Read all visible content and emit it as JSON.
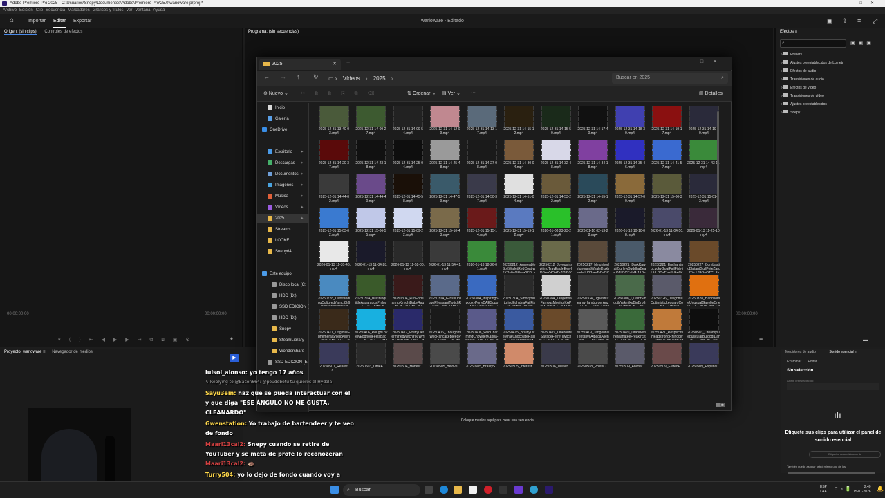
{
  "app": {
    "title": "Adobe Premiere Pro 2025 - C:\\Usuarios\\Snepy\\Documentos\\Adobe\\Premiere Pro\\25.0\\warioware.prproj *",
    "menu": [
      "Archivo",
      "Edición",
      "Clip",
      "Secuencia",
      "Marcadores",
      "Gráficos y títulos",
      "Ver",
      "Ventana",
      "Ayuda"
    ],
    "tabs": {
      "import": "Importar",
      "edit": "Editar",
      "export": "Exportar"
    },
    "project_title": "warioware - Editado"
  },
  "source_panel": {
    "tab_source": "Origen: (sin clips)",
    "tab_controls": "Controles de efectos",
    "timecode": "00;00;00;00",
    "timecode2": "00;00;00;00"
  },
  "program_panel": {
    "tab": "Programa: (sin secuencias)",
    "timecode": "00;00;00;00",
    "timecode_right": "00;00;00;00",
    "drop_hint": "Coloque medios aquí para crear una secuencia."
  },
  "effects_panel": {
    "tab": "Efectos",
    "items": [
      "Presets",
      "Ajustes preestablecidos de Lumetri",
      "Efectos de audio",
      "Transiciones de audio",
      "Efectos de vídeo",
      "Transiciones de vídeo",
      "Ajustes preestablecidos",
      "Snepy"
    ]
  },
  "project_panel": {
    "tab": "Proyecto: warioware",
    "tab2": "Navegador de medios"
  },
  "audio_panel": {
    "tab1": "Medidores de audio",
    "tab2": "Sonido esencial",
    "sub1": "Examinar",
    "sub2": "Editar",
    "selection": "Sin selección",
    "preset_label": "Ajuste preestablecido:",
    "heading": "Etiquete sus clips para utilizar el panel de sonido esencial",
    "auto_btn": "Etiquetar automáticamente",
    "foot": "También puede asignar usted mismo uno de los"
  },
  "explorer": {
    "tab_title": "2025",
    "breadcrumb": [
      "Vídeos",
      "2025"
    ],
    "search_placeholder": "Buscar en 2025",
    "toolbar": {
      "new": "Nuevo",
      "sort": "Ordenar",
      "view": "Ver",
      "details": "Detalles"
    },
    "sidebar": [
      {
        "label": "Inicio",
        "icon": "home-icon",
        "color": "#d9d9d9"
      },
      {
        "label": "Galería",
        "icon": "gallery-icon",
        "color": "#5aa0e8"
      },
      {
        "label": "OneDrive",
        "icon": "cloud-icon",
        "color": "#3a8ee6"
      },
      {
        "label": "Escritorio",
        "icon": "desktop-icon",
        "color": "#4b9be8"
      },
      {
        "label": "Descargas",
        "icon": "download-icon",
        "color": "#45b06a"
      },
      {
        "label": "Documentos",
        "icon": "document-icon",
        "color": "#6f9fd8"
      },
      {
        "label": "Imágenes",
        "icon": "image-icon",
        "color": "#4aa3df"
      },
      {
        "label": "Música",
        "icon": "music-icon",
        "color": "#e0603a"
      },
      {
        "label": "Vídeos",
        "icon": "video-icon",
        "color": "#9b5ce0"
      },
      {
        "label": "2025",
        "icon": "folder-icon",
        "color": "#e8b84a"
      },
      {
        "label": "Streams",
        "icon": "folder-icon",
        "color": "#e8b84a"
      },
      {
        "label": "LOCKE",
        "icon": "folder-icon",
        "color": "#e8b84a"
      },
      {
        "label": "Snepy64",
        "icon": "folder-icon",
        "color": "#e8b84a"
      },
      {
        "label": "Este equipo",
        "icon": "computer-icon",
        "color": "#4b9be8"
      },
      {
        "label": "Disco local (C:",
        "icon": "drive-icon",
        "color": "#999"
      },
      {
        "label": "HDD (D:)",
        "icon": "drive-icon",
        "color": "#999"
      },
      {
        "label": "SSD EDICION (",
        "icon": "drive-icon",
        "color": "#999"
      },
      {
        "label": "HDD (D:)",
        "icon": "drive-icon",
        "color": "#999"
      },
      {
        "label": "Snepy",
        "icon": "folder-icon",
        "color": "#e8b84a"
      },
      {
        "label": "SteamLibrary",
        "icon": "folder-icon",
        "color": "#e8b84a"
      },
      {
        "label": "Wondershare",
        "icon": "folder-icon",
        "color": "#e8b84a"
      },
      {
        "label": "SSD EDICION (E:",
        "icon": "drive-icon",
        "color": "#999"
      }
    ],
    "files": [
      {
        "name": "2025-12-31 13-40-03.mp4",
        "color": "#4a5a3a"
      },
      {
        "name": "2025-12-31 14-09-27.mp4",
        "color": "#3d5a30"
      },
      {
        "name": "2025-12-31 14-09-54.mp4",
        "color": "#222"
      },
      {
        "name": "2025-12-31 14-12-09.mp4",
        "color": "#c08890"
      },
      {
        "name": "2025-12-31 14-13-17.mp4",
        "color": "#5a6a7a"
      },
      {
        "name": "2025-12-31 14-15-12.mp4",
        "color": "#2a2010"
      },
      {
        "name": "2025-12-31 14-15-50.mp4",
        "color": "#1a2a1a"
      },
      {
        "name": "2025-12-31 14-17-40.mp4",
        "color": "#111"
      },
      {
        "name": "2025-12-31 14-18-30.mp4",
        "color": "#4040b0"
      },
      {
        "name": "2025-12-31 14-19-17.mp4",
        "color": "#8a1010"
      },
      {
        "name": "2025-12-31 14-19-30.mp4",
        "color": "#2a2a3a"
      },
      {
        "name": "2025-12-31 14-20-37.mp4",
        "color": "#5a0a0a"
      },
      {
        "name": "2025-12-31 14-23-18.mp4",
        "color": "#111"
      },
      {
        "name": "2025-12-31 14-25-04.mp4",
        "color": "#0e0e0e"
      },
      {
        "name": "2025-12-31 14-25-48.mp4",
        "color": "#9a9a9a"
      },
      {
        "name": "2025-12-31 14-27-08.mp4",
        "color": "#1a1a1a"
      },
      {
        "name": "2025-12-31 14-30-04.mp4",
        "color": "#7a5a3a"
      },
      {
        "name": "2025-12-31 14-32-48.mp4",
        "color": "#d8d8e8"
      },
      {
        "name": "2025-12-31 14-34-18.mp4",
        "color": "#8040a0"
      },
      {
        "name": "2025-12-31 14-35-46.mp4",
        "color": "#3030c0"
      },
      {
        "name": "2025-12-31 14-41-57.mp4",
        "color": "#3a6ad0"
      },
      {
        "name": "2025-12-31 14-43-11.mp4",
        "color": "#3a8a3a"
      },
      {
        "name": "2025-12-31 14-44-02.mp4",
        "color": "#3a3a3a"
      },
      {
        "name": "2025-12-31 14-44-40.mp4",
        "color": "#6a4a8a"
      },
      {
        "name": "2025-12-31 14-45-58.mp4",
        "color": "#1a1008"
      },
      {
        "name": "2025-12-31 14-47-59.mp4",
        "color": "#3a5a6a"
      },
      {
        "name": "2025-12-31 14-50-37.mp4",
        "color": "#3a3a4a"
      },
      {
        "name": "2025-12-31 14-51-04.mp4",
        "color": "#e0e0e0"
      },
      {
        "name": "2025-12-31 14-53-22.mp4",
        "color": "#6a5a3a"
      },
      {
        "name": "2025-12-31 14-55-12.mp4",
        "color": "#2a4a5a"
      },
      {
        "name": "2025-12-31 14-57-00.mp4",
        "color": "#8a6a3a"
      },
      {
        "name": "2025-12-31 15-00-34.mp4",
        "color": "#5a5a3a"
      },
      {
        "name": "2025-12-31 15-01-13.mp4",
        "color": "#2a2a3a"
      },
      {
        "name": "2025-12-31 15-03-02.mp4",
        "color": "#3a7ad0"
      },
      {
        "name": "2025-12-31 15-06-55.mp4",
        "color": "#c0c8e8"
      },
      {
        "name": "2025-12-31 15-09-22.mp4",
        "color": "#d0d8f0"
      },
      {
        "name": "2025-12-31 15-10-43.mp4",
        "color": "#7a6a4a"
      },
      {
        "name": "2025-12-31 15-15-14.mp4",
        "color": "#6a1a1a"
      },
      {
        "name": "2025-12-31 15-19-12.mp4",
        "color": "#5a7ac0"
      },
      {
        "name": "2026-01-08 23-23-21.mp4",
        "color": "#2ac02a"
      },
      {
        "name": "2026-01-10 02-13-28.mp4",
        "color": "#6a6a8a"
      },
      {
        "name": "2026-01-13 10-10-08.mp4",
        "color": "#1a1a2a"
      },
      {
        "name": "2026-01-13 11-04-50.mp4",
        "color": "#4a4a6a"
      },
      {
        "name": "2026-01-13 11-25-10.mp4",
        "color": "#3a2a3a"
      },
      {
        "name": "2026-01-13 11-31-46.mp4",
        "color": "#e8e8e8"
      },
      {
        "name": "2026-01-13 11-34-28.mp4",
        "color": "#1a1a2a"
      },
      {
        "name": "2026-01-13 11-52-00.mp4",
        "color": "#2a2a2a"
      },
      {
        "name": "2026-01-13 11-54-41.mp4",
        "color": "#3a3a3a"
      },
      {
        "name": "2026-01-13 18-26-01.mp4",
        "color": "#3a8a3a"
      },
      {
        "name": "20250212_AgreeableSoftWalletRedCoat-w6XRs9eQ8bez2ER_sourc...",
        "color": "#3a5a3a"
      },
      {
        "name": "20250212_JoyousInspiringTrayEagleEye-fDPmKdQHEy1P8VK_sourc...",
        "color": "#6a6a4a"
      },
      {
        "name": "20250217_NeighborlyIgnorantWhaleDxAbomb-lU2PzmTsFsOYZHVe_s...",
        "color": "#5a4a3a"
      },
      {
        "name": "20250221_DarkKawaiiCurlewBuddhaBear-O4LPGEvIkWJAPwb4_sourc...",
        "color": "#4a5a6a"
      },
      {
        "name": "20250221_EnchantingLuckyGoatFailFish-jLNLRRaF-m5Nhp6K_source...",
        "color": "#8a8aa0"
      },
      {
        "name": "20250227_BombasticBlatantGullPeteZarollTie-LJ8QnOTGL3aCi4_4b_s...",
        "color": "#6a4a2a"
      },
      {
        "name": "20250228_OutstandingCulturedYamLi8h6n-KTWS530P6EEGoeol_...",
        "color": "#4a8ac0"
      },
      {
        "name": "20250304_BlushingLittleAsparagusPhilosoraptor-XnrjAZ9HDqAnAa...",
        "color": "#3a5a2a"
      },
      {
        "name": "20250304_FunEndearingKimchiBabyRage-RuZzb8UuNbrQdvMb...",
        "color": "#3a1a1a"
      },
      {
        "name": "20250304_GrossObliquePheasantTwitchRaid-ZPrnjEGahW1AAOdo_...",
        "color": "#5a6a8a"
      },
      {
        "name": "20250304_InspiringSpookyPonyDAESuppy-WlNnb2iEXVGMwje_so...",
        "color": "#3a6ac0"
      },
      {
        "name": "20250304_SmokyNurturingEchidnaFailFish-gj3a3MNkrXBKPL-m_s...",
        "color": "#2a2a2a"
      },
      {
        "name": "20250304_TangentialFamousMonitorKAPOW-WD7ekkGWVPjPRFLZ...",
        "color": "#d0d0d0"
      },
      {
        "name": "20250304_UgliestDreamyHamburgerAnzonNoSexy-kfCuiLYTIINgGjI...",
        "color": "#3a3a3a"
      },
      {
        "name": "20250308_QuaintSmoothYakinikuBigBrother--KHPPRoEumFX-4f...",
        "color": "#4a6a4a"
      },
      {
        "name": "20250326_DelightfulOptimisticLeopardCouch-izD6pvMD6NLmOurB...",
        "color": "#5a5a6a"
      },
      {
        "name": "20250328_HandsomeUnusualGazelleOneHand--xRUG_7GqVZaJb...",
        "color": "#e07010"
      },
      {
        "name": "20250411_LitigiousEphemeralShieldAliens-3H3v6AEwLHmuP8_so...",
        "color": "#3a2a1a"
      },
      {
        "name": "20250416_RoughLovelyEggnogFeelsBadMan-xBcyRyLcaic1Map_so...",
        "color": "#18b0e0"
      },
      {
        "name": "20250417_PrettyDeterminedWitchYouWHY-LPltPd6FqhOYrs-7_sou...",
        "color": "#2a2a6a"
      },
      {
        "name": "20250406_ThoughtfulWildPancakeBleedPurple-YH2LesIOeT8wJF3...",
        "color": "#1a1a1a"
      },
      {
        "name": "20250406_WildCharmingChowderKappa-5CKOozKQeUe95_GR_so...",
        "color": "#5a5a8a"
      },
      {
        "name": "20250415_BrainyLivelyYakChocolateRain-0bpL50xl6GKW55Av_so...",
        "color": "#3a5aa0"
      },
      {
        "name": "20250419_OneroursSavageFerretTwitchRaid-0YKIsdqByZFcygYvD_s...",
        "color": "#6a4a2a"
      },
      {
        "name": "20250419_TangentialTentativeAlpacaAliens-2CnnnbFbis8F8gIF_sourc...",
        "color": "#5a5a5a"
      },
      {
        "name": "20250420_DrabBovineManateeFreakinStinkin-L8fbPtxUvzcJeB9i8_sou...",
        "color": "#3a6a3a"
      },
      {
        "name": "20250421_RespectfulHeadstrongRhinocerosANELE-C5-EF5t97tSpP...",
        "color": "#c07a3a"
      },
      {
        "name": "20250503_DreamyCrepuscularBulgogiDansGame-2DqTbyjF9pYWY...",
        "color": "#0e0e0e"
      },
      {
        "name": "20250501_Realistic...",
        "color": "#3a3a5a"
      },
      {
        "name": "20250503_LittleA...",
        "color": "#2a2a2a"
      },
      {
        "name": "20250504_Honest...",
        "color": "#5a4a4a"
      },
      {
        "name": "20250505_Belove...",
        "color": "#4a4a4a"
      },
      {
        "name": "20250505_BrainyS...",
        "color": "#6a6a8a"
      },
      {
        "name": "20250505_Interest...",
        "color": "#d08a6a"
      },
      {
        "name": "20250506_Wealth...",
        "color": "#3a3a4a"
      },
      {
        "name": "20250508_PoliteC...",
        "color": "#4a4a4a"
      },
      {
        "name": "20250509_Animat...",
        "color": "#5a5a6a"
      },
      {
        "name": "20250509_ElatedP...",
        "color": "#6a4a4a"
      },
      {
        "name": "20250509_Expensi...",
        "color": "#3a3a5a"
      }
    ]
  },
  "chat": [
    {
      "user": "luisol_alonso:",
      "text": " yo tengo 17 años",
      "ucolor": "#ffffff"
    },
    {
      "user": "",
      "text": "↳ Replying to @Bacon664: @poudobotu tu quieres el Hydala",
      "ucolor": "#aaaaaa"
    },
    {
      "user": "Sayu3ein:",
      "text": " haz que se pueda interactuar con el",
      "ucolor": "#ffd84a"
    },
    {
      "user": "",
      "text": "y que diga \"ESE ÁNGULO NO ME GUSTA,",
      "ucolor": "#ffffff"
    },
    {
      "user": "",
      "text": "CLEANARDO\"",
      "ucolor": "#ffffff"
    },
    {
      "user": "Gwenstation:",
      "text": " Yo trabajo de bartendeer y te veo",
      "ucolor": "#ffd84a"
    },
    {
      "user": "",
      "text": "de fondo",
      "ucolor": "#ffffff"
    },
    {
      "user": "Maari13cal2:",
      "text": " Snepy cuando se retire de",
      "ucolor": "#d24040"
    },
    {
      "user": "",
      "text": "YouTuber y se meta de profe lo reconozeran",
      "ucolor": "#ffffff"
    },
    {
      "user": "Maari13cal2:",
      "text": " 🦔",
      "ucolor": "#d24040"
    },
    {
      "user": "Turry504:",
      "text": " yo lo dejo de fondo cuando voy a",
      "ucolor": "#ffd84a"
    },
    {
      "user": "",
      "text": "dormir",
      "ucolor": "#ffffff"
    }
  ],
  "taskbar": {
    "search": "Buscar",
    "lang1": "ESP",
    "lang2": "LAA",
    "time": "2:40",
    "date": "15-01-2026"
  }
}
